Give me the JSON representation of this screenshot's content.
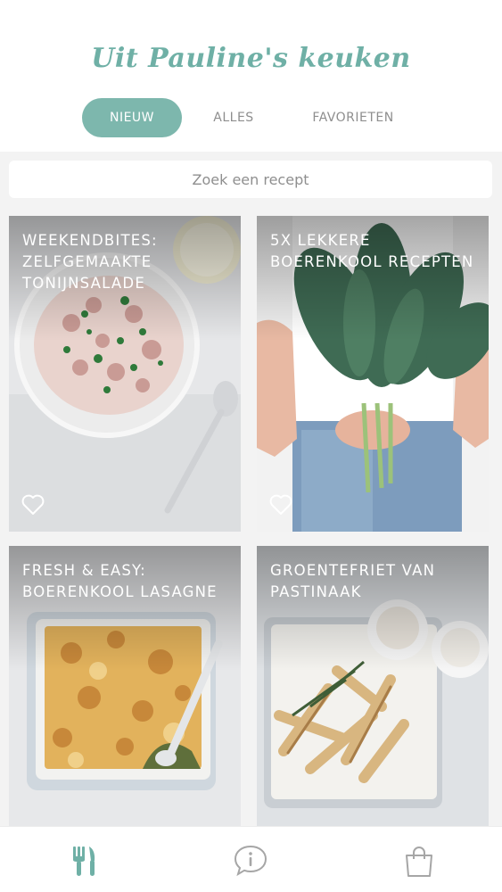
{
  "app": {
    "title": "Uit Pauline's keuken"
  },
  "tabs": [
    {
      "label": "NIEUW",
      "active": true
    },
    {
      "label": "ALLES",
      "active": false
    },
    {
      "label": "FAVORIETEN",
      "active": false
    }
  ],
  "search": {
    "placeholder": "Zoek een recept",
    "value": ""
  },
  "recipes": [
    {
      "title": "WEEKENDBITES: ZELFGEMAAKTE TONIJNSALADE",
      "favorite": false
    },
    {
      "title": "5X LEKKERE BOERENKOOL RECEPTEN",
      "favorite": false
    },
    {
      "title": "FRESH & EASY: BOERENKOOL LASAGNE",
      "favorite": false
    },
    {
      "title": "GROENTEFRIET VAN PASTINAAK",
      "favorite": false
    }
  ],
  "bottom_nav": [
    {
      "icon": "fork-knife-icon",
      "active": true
    },
    {
      "icon": "info-icon",
      "active": false
    },
    {
      "icon": "shopping-bag-icon",
      "active": false
    }
  ],
  "colors": {
    "accent": "#7db7ad",
    "logo": "#6fb0a6",
    "inactive": "#8e8e8e"
  }
}
